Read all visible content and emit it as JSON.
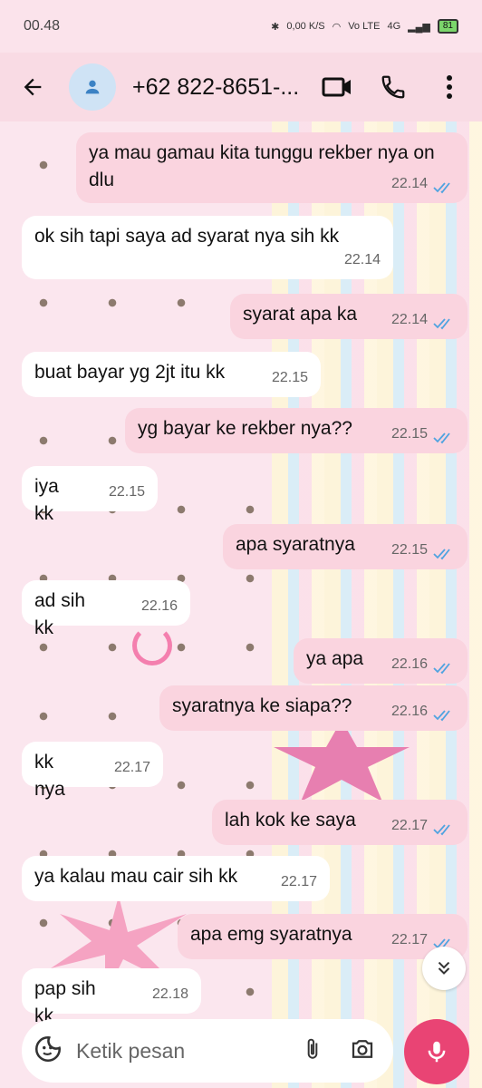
{
  "status_bar": {
    "time": "00.48",
    "net_speed": "0,00 K/S",
    "volte": "Vo LTE",
    "network": "4G",
    "battery": "81"
  },
  "header": {
    "contact": "+62 822-8651-..."
  },
  "messages": [
    {
      "dir": "out",
      "text": "ya mau gamau kita tunggu rekber nya on dlu",
      "time": "22.14",
      "read": true
    },
    {
      "dir": "in",
      "text": "ok sih tapi saya ad syarat nya sih kk",
      "time": "22.14"
    },
    {
      "dir": "out",
      "text": "syarat apa ka",
      "time": "22.14",
      "read": true
    },
    {
      "dir": "in",
      "text": "buat bayar yg 2jt itu kk",
      "time": "22.15"
    },
    {
      "dir": "out",
      "text": "yg bayar ke rekber nya??",
      "time": "22.15",
      "read": true
    },
    {
      "dir": "in",
      "text": "iya kk",
      "time": "22.15"
    },
    {
      "dir": "out",
      "text": "apa syaratnya",
      "time": "22.15",
      "read": true
    },
    {
      "dir": "in",
      "text": "ad sih kk",
      "time": "22.16"
    },
    {
      "dir": "out",
      "text": "ya apa",
      "time": "22.16",
      "read": true
    },
    {
      "dir": "out",
      "text": "syaratnya ke siapa??",
      "time": "22.16",
      "read": true
    },
    {
      "dir": "in",
      "text": "kk nya",
      "time": "22.17"
    },
    {
      "dir": "out",
      "text": "lah kok ke saya",
      "time": "22.17",
      "read": true
    },
    {
      "dir": "in",
      "text": "ya kalau mau cair sih kk",
      "time": "22.17"
    },
    {
      "dir": "out",
      "text": "apa emg syaratnya",
      "time": "22.17",
      "read": true
    },
    {
      "dir": "in",
      "text": "pap sih kk",
      "time": "22.18"
    }
  ],
  "composer": {
    "placeholder": "Ketik pesan"
  },
  "icons": {
    "back": "arrow-left-icon",
    "avatar": "person-icon",
    "video": "video-camera-icon",
    "call": "phone-icon",
    "menu": "more-vertical-icon",
    "emoji": "sticker-icon",
    "attach": "paperclip-icon",
    "camera": "camera-icon",
    "mic": "microphone-icon",
    "scroll": "double-chevron-down-icon"
  },
  "colors": {
    "outgoing_bubble": "#fad4df",
    "incoming_bubble": "#ffffff",
    "read_tick": "#4fa3e0",
    "mic_button": "#e94474"
  }
}
